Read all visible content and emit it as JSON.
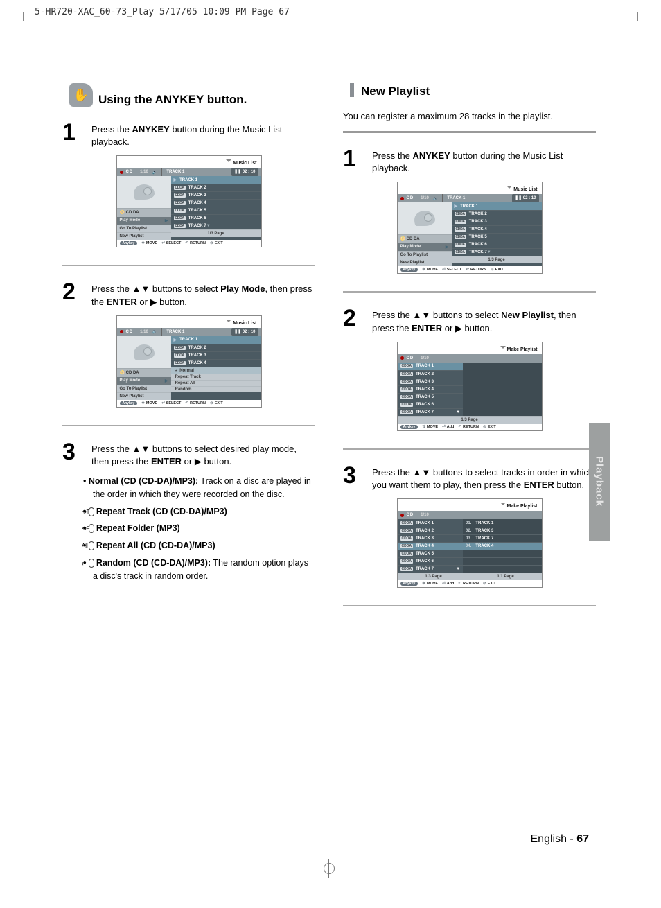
{
  "printinfo": "5-HR720-XAC_60-73_Play  5/17/05  10:09 PM  Page 67",
  "tab": "Playback",
  "footer_lang": "English",
  "footer_sep": " - ",
  "footer_page": "67",
  "left": {
    "heading": "Using the ANYKEY button.",
    "icon": "✋",
    "step1": {
      "pre": "Press the ",
      "bold": "ANYKEY",
      "post": " button during the Music List playback."
    },
    "step2": {
      "pre": "Press the ▲▼ buttons to select ",
      "bold": "Play Mode",
      "post": ", then press the ",
      "bold2": "ENTER",
      "post2": " or ▶ button."
    },
    "step3": {
      "pre": "Press the ▲▼ buttons to select desired play mode, then press the ",
      "bold": "ENTER",
      "post": " or ▶ button."
    },
    "opts": {
      "normal_b": "Normal (CD (CD-DA)/MP3):",
      "normal_t": " Track on a disc are played in the order in which they were recorded on the disc.",
      "rpt_track": "Repeat Track (CD (CD-DA)/MP3)",
      "rpt_folder": "Repeat Folder (MP3)",
      "rpt_all": "Repeat All (CD (CD-DA)/MP3)",
      "random_b": "Random (CD (CD-DA)/MP3):",
      "random_t": " The random option plays a disc's track in random order."
    }
  },
  "right": {
    "heading": "New Playlist",
    "intro": "You can register a maximum 28 tracks in the playlist.",
    "step1": {
      "pre": "Press the ",
      "bold": "ANYKEY",
      "post": " button during the Music List playback."
    },
    "step2": {
      "pre": "Press the ▲▼ buttons to select ",
      "bold": "New Playlist",
      "post": ", then press the ",
      "bold2": "ENTER",
      "post2": " or ▶ button."
    },
    "step3": {
      "pre": "Press the ▲▼ buttons to select tracks in order in which you want them to play, then press the ",
      "bold": "ENTER",
      "post": " button."
    }
  },
  "osd": {
    "title_music": "Music List",
    "title_make": "Make Playlist",
    "cd": "CD",
    "index": "1/10",
    "track_header": "TRACK  1",
    "time": "02 : 10",
    "cdda": "CDDA",
    "tracks": [
      "TRACK 1",
      "TRACK 2",
      "TRACK 3",
      "TRACK 4",
      "TRACK 5",
      "TRACK 6",
      "TRACK 7"
    ],
    "menus": {
      "cd_da": "CD DA",
      "play_mode": "Play Mode",
      "go_playlist": "Go To Playlist",
      "new_playlist": "New Playlist"
    },
    "submenu": [
      "Normal",
      "Repeat Track",
      "Repeat All",
      "Random"
    ],
    "pager_13": "1/3 Page",
    "pager_11": "1/1 Page",
    "foot": {
      "anykey": "Anykey",
      "move": "MOVE",
      "select": "SELECT",
      "add": "Add",
      "return": "RETURN",
      "exit": "EXIT"
    },
    "make3_right": [
      {
        "n": "01.",
        "t": "TRACK 1"
      },
      {
        "n": "02.",
        "t": "TRACK 3"
      },
      {
        "n": "03.",
        "t": "TRACK 7"
      },
      {
        "n": "04.",
        "t": "TRACK 4"
      }
    ]
  }
}
